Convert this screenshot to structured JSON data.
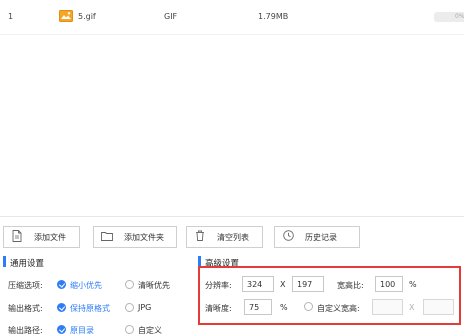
{
  "file_table": {
    "rows": [
      {
        "index": "1",
        "name": "5.gif",
        "type": "GIF",
        "size": "1.79MB",
        "progress": "0%",
        "icon": "gif-file-icon"
      }
    ]
  },
  "toolbar": {
    "add_file": "添加文件",
    "add_folder": "添加文件夹",
    "clear_list": "清空列表",
    "history": "历史记录"
  },
  "general": {
    "title": "通用设置",
    "compress_label": "压缩选项:",
    "compress_options": [
      "缩小优先",
      "清晰优先"
    ],
    "compress_selected": "缩小优先",
    "format_label": "输出格式:",
    "format_options": [
      "保持原格式",
      "JPG"
    ],
    "format_selected": "保持原格式",
    "output_label": "输出路径:",
    "output_options": [
      "原目录",
      "自定义"
    ],
    "output_selected": "原目录"
  },
  "advanced": {
    "title": "高级设置",
    "resolution_label": "分辨率:",
    "width_value": "324",
    "x_sep": "X",
    "height_value": "197",
    "aspect_label": "宽高比:",
    "aspect_value": "100",
    "aspect_unit": "%",
    "clarity_label": "清晰度:",
    "clarity_value": "75",
    "clarity_unit": "%",
    "custom_wh_label": "自定义宽高:",
    "custom_width_value": "",
    "custom_x_sep": "X",
    "custom_height_value": ""
  },
  "colors": {
    "accent": "#2e7cf6",
    "highlight": "#e23b3b",
    "gif_icon": "#f5a623"
  }
}
